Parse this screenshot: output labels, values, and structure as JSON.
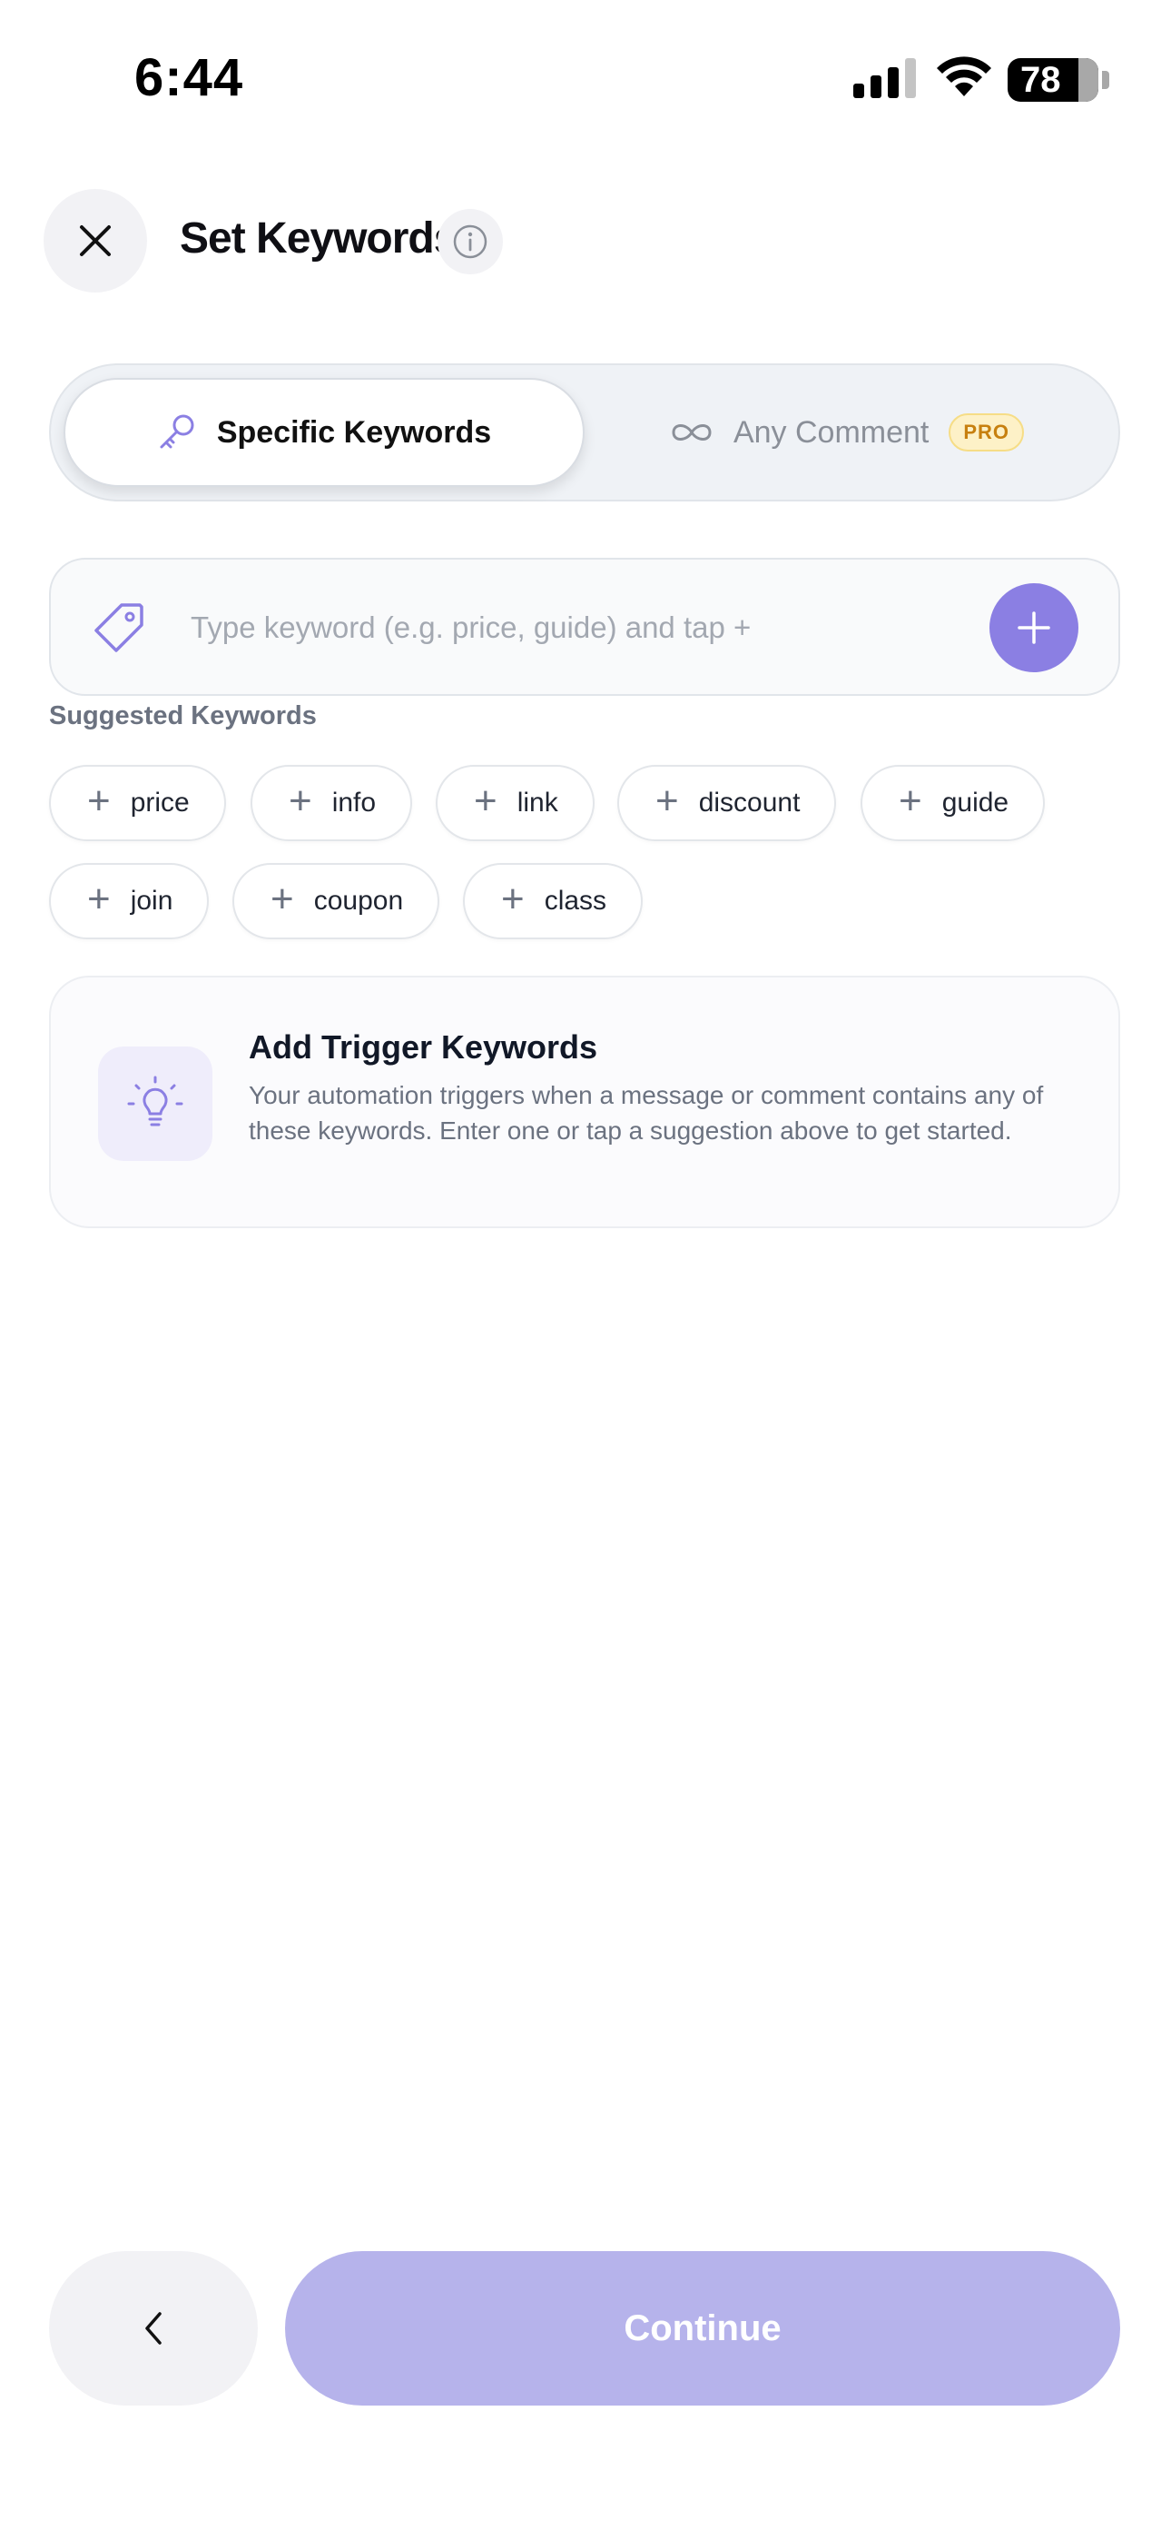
{
  "status_bar": {
    "time": "6:44",
    "battery": "78",
    "battery_level": 0.78
  },
  "header": {
    "title": "Set Keywords"
  },
  "tabs": {
    "specific_label": "Specific Keywords",
    "any_label": "Any Comment",
    "pro_badge": "PRO",
    "selected": "specific"
  },
  "keyword_input": {
    "placeholder": "Type keyword (e.g. price, guide) and tap +",
    "value": ""
  },
  "suggested": {
    "label": "Suggested Keywords",
    "chips": [
      "price",
      "info",
      "link",
      "discount",
      "guide",
      "join",
      "coupon",
      "class"
    ]
  },
  "info_card": {
    "title": "Add Trigger Keywords",
    "body": "Your automation triggers when a message or comment contains any of these keywords. Enter one or tap a suggestion above to get started."
  },
  "footer": {
    "continue_label": "Continue"
  },
  "colors": {
    "accent": "#8b7fe3",
    "continue_disabled": "#b6b3eb",
    "pro_text": "#c7800f"
  }
}
